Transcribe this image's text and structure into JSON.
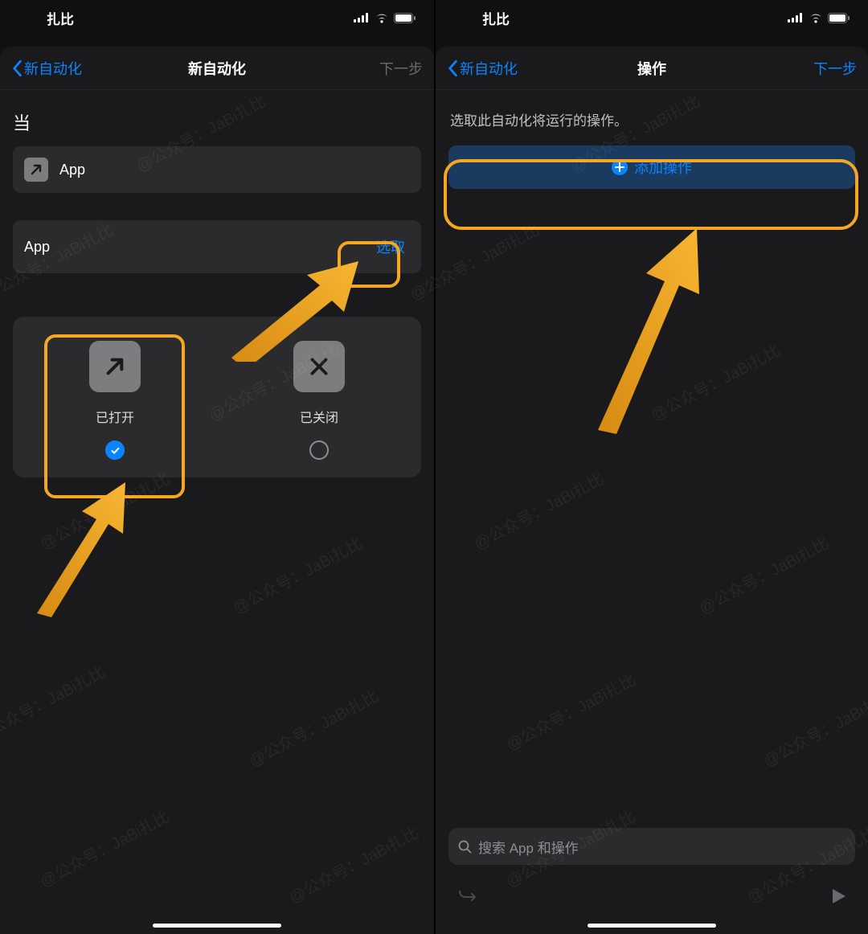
{
  "statusbar": {
    "carrier": "扎比"
  },
  "screen1": {
    "nav": {
      "back": "新自动化",
      "title": "新自动化",
      "next": "下一步"
    },
    "when_label": "当",
    "trigger_row": {
      "label": "App"
    },
    "app_row": {
      "label": "App",
      "choose": "选取"
    },
    "options": {
      "opened": "已打开",
      "closed": "已关闭"
    }
  },
  "screen2": {
    "nav": {
      "back": "新自动化",
      "title": "操作",
      "next": "下一步"
    },
    "instruction": "选取此自动化将运行的操作。",
    "add_action": "添加操作",
    "search_placeholder": "搜索 App 和操作"
  },
  "watermark": "@公众号：JaBi扎比"
}
